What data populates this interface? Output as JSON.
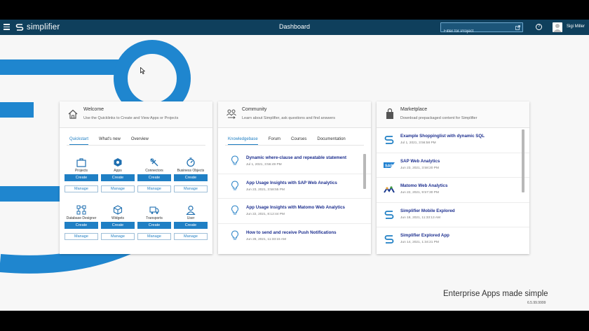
{
  "header": {
    "app_name": "simplifier",
    "title": "Dashboard",
    "filter_placeholder": "Filter for Project",
    "help_symbol": "?",
    "user_name": "Sigi Miller"
  },
  "colors": {
    "header_bg": "#0f3f5c",
    "brand_blue": "#1f7fc4",
    "link_navy": "#1d2f8f"
  },
  "welcome": {
    "title": "Welcome",
    "subtitle": "Use the Quicklinks to Create and View Apps or Projects",
    "icon": "home-icon",
    "tabs": [
      "Quickstart",
      "What's new",
      "Overview"
    ],
    "active_tab": "Quickstart",
    "create_label": "Create",
    "manage_label": "Manage",
    "quicklinks": [
      {
        "label": "Projects",
        "icon": "briefcase-icon"
      },
      {
        "label": "Apps",
        "icon": "apps-icon"
      },
      {
        "label": "Connectors",
        "icon": "connector-icon"
      },
      {
        "label": "Business Objects",
        "icon": "business-object-icon"
      },
      {
        "label": "Database Designer",
        "icon": "database-icon"
      },
      {
        "label": "Widgets",
        "icon": "widget-icon"
      },
      {
        "label": "Transports",
        "icon": "truck-icon"
      },
      {
        "label": "User",
        "icon": "user-icon"
      }
    ]
  },
  "community": {
    "title": "Community",
    "subtitle": "Learn about Simplifier, ask questions and find answers",
    "icon": "community-icon",
    "tabs": [
      "Knowledgebase",
      "Forum",
      "Courses",
      "Documentation"
    ],
    "active_tab": "Knowledgebase",
    "items": [
      {
        "title": "Dynamic where-clause and repeatable statement",
        "date": "Jul 1, 2021, 3:56:49 PM"
      },
      {
        "title": "App Usage Insights with SAP Web Analytics",
        "date": "Jun 23, 2021, 3:58:55 PM"
      },
      {
        "title": "App Usage Insights with Matomo Web Analytics",
        "date": "Jun 22, 2021, 8:12:44 PM"
      },
      {
        "title": "How to send and receive Push Notifications",
        "date": "Jun 28, 2021, 11:33:15 AM"
      }
    ]
  },
  "marketplace": {
    "title": "Marketplace",
    "subtitle": "Download prepackaged content for Simplifier",
    "icon": "shopping-bag-icon",
    "items": [
      {
        "title": "Example Shoppinglist with dynamic SQL",
        "date": "Jul 1, 2021, 3:56:58 PM",
        "icon": "simplifier-logo-icon"
      },
      {
        "title": "SAP Web Analytics",
        "date": "Jun 23, 2021, 3:58:20 PM",
        "icon": "sap-logo-icon"
      },
      {
        "title": "Matomo Web Analytics",
        "date": "Jun 22, 2021, 9:57:30 PM",
        "icon": "matomo-logo-icon"
      },
      {
        "title": "Simplifier Mobile Explored",
        "date": "Jun 18, 2021, 11:33:13 AM",
        "icon": "simplifier-logo-icon"
      },
      {
        "title": "Simplifier Explored App",
        "date": "Jun 14, 2021, 1:34:21 PM",
        "icon": "simplifier-logo-icon"
      }
    ]
  },
  "footer": {
    "tagline": "Enterprise Apps made simple",
    "version": "6.5.99.9999"
  }
}
